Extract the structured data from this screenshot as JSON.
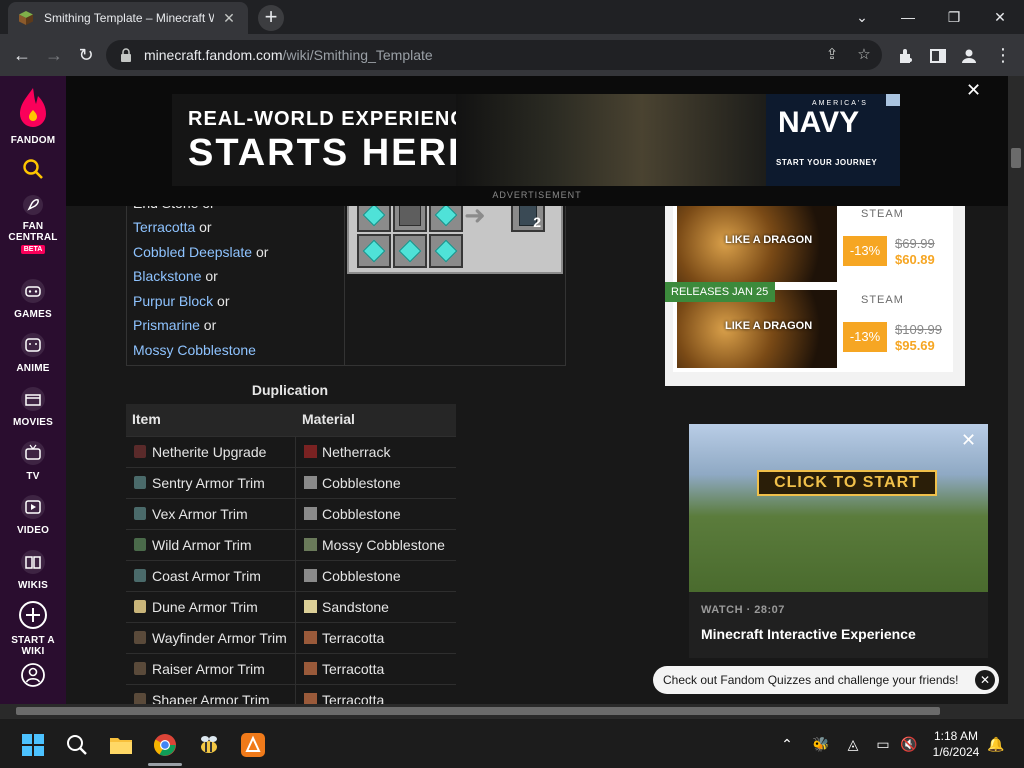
{
  "browser": {
    "tab_title": "Smithing Template – Minecraft W",
    "new_tab_label": "+",
    "url_host": "minecraft.fandom.com",
    "url_path": "/wiki/Smithing_Template"
  },
  "rail": {
    "brand": "FANDOM",
    "items": [
      {
        "label": "FAN CENTRAL",
        "badge": "BETA"
      },
      {
        "label": "GAMES"
      },
      {
        "label": "ANIME"
      },
      {
        "label": "MOVIES"
      },
      {
        "label": "TV"
      },
      {
        "label": "VIDEO"
      },
      {
        "label": "WIKIS"
      },
      {
        "label": "START A WIKI"
      }
    ]
  },
  "ad": {
    "line1": "REAL-WORLD EXPERIENCE",
    "line2": "STARTS HERE",
    "brand_small": "AMERICA'S",
    "brand": "NAVY",
    "cta": "START YOUR JOURNEY",
    "label": "ADVERTISEMENT"
  },
  "recipe": {
    "partial_top": "End Stone or",
    "ingredients": [
      {
        "name": "Terracotta",
        "suffix": " or"
      },
      {
        "name": "Cobbled Deepslate",
        "suffix": " or"
      },
      {
        "name": "Blackstone",
        "suffix": " or"
      },
      {
        "name": "Purpur Block",
        "suffix": " or"
      },
      {
        "name": "Prismarine",
        "suffix": " or"
      },
      {
        "name": "Mossy Cobblestone",
        "suffix": ""
      }
    ],
    "output_count": "2"
  },
  "duplication": {
    "title": "Duplication",
    "col_item": "Item",
    "col_material": "Material",
    "rows": [
      {
        "item": "Netherite Upgrade",
        "material": "Netherrack",
        "item_color": "#5a2a2a",
        "mat_color": "#7a2222"
      },
      {
        "item": "Sentry Armor Trim",
        "material": "Cobblestone",
        "item_color": "#4a6a6a",
        "mat_color": "#8a8a8a"
      },
      {
        "item": "Vex Armor Trim",
        "material": "Cobblestone",
        "item_color": "#4a6a6a",
        "mat_color": "#8a8a8a"
      },
      {
        "item": "Wild Armor Trim",
        "material": "Mossy Cobblestone",
        "item_color": "#4a6a4a",
        "mat_color": "#6a7a5a"
      },
      {
        "item": "Coast Armor Trim",
        "material": "Cobblestone",
        "item_color": "#4a6a6a",
        "mat_color": "#8a8a8a"
      },
      {
        "item": "Dune Armor Trim",
        "material": "Sandstone",
        "item_color": "#c9b57a",
        "mat_color": "#dccf97"
      },
      {
        "item": "Wayfinder Armor Trim",
        "material": "Terracotta",
        "item_color": "#5a4a3a",
        "mat_color": "#9a5a3a"
      },
      {
        "item": "Raiser Armor Trim",
        "material": "Terracotta",
        "item_color": "#5a4a3a",
        "mat_color": "#9a5a3a"
      },
      {
        "item": "Shaper Armor Trim",
        "material": "Terracotta",
        "item_color": "#5a4a3a",
        "mat_color": "#9a5a3a"
      }
    ]
  },
  "steam_ad": {
    "cards": [
      {
        "store": "STEAM",
        "discount": "-13%",
        "old_price": "$69.99",
        "new_price": "$60.89",
        "art_label": "LIKE A DRAGON"
      },
      {
        "store": "STEAM",
        "discount": "-13%",
        "old_price": "$109.99",
        "new_price": "$95.69",
        "art_label": "LIKE A DRAGON"
      }
    ],
    "release_badge": "RELEASES JAN 25"
  },
  "video": {
    "cta": "CLICK TO START",
    "meta": "WATCH · 28:07",
    "title": "Minecraft Interactive Experience"
  },
  "toast": {
    "text": "Check out Fandom Quizzes and challenge your friends!"
  },
  "taskbar": {
    "time": "1:18 AM",
    "date": "1/6/2024"
  },
  "colors": {
    "fandom_rail": "#2a0d2f",
    "link": "#8ec3ff",
    "accent_orange": "#f6a623",
    "chrome_bg": "#202124"
  }
}
